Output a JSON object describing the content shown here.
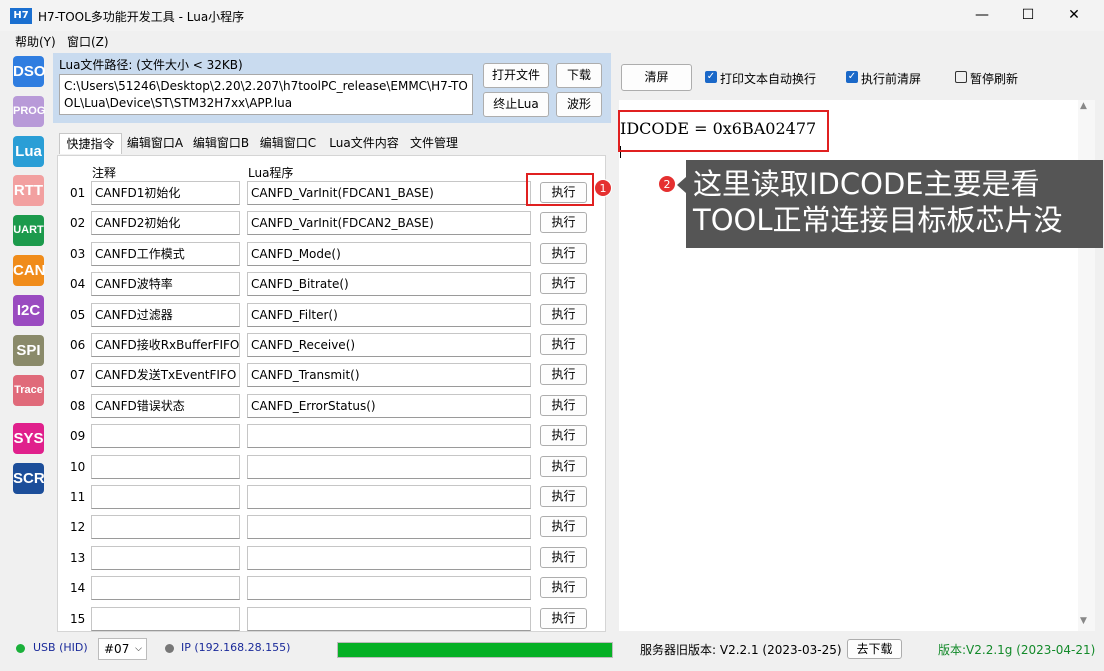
{
  "window": {
    "icon_text": "H7",
    "title": "H7-TOOL多功能开发工具 - Lua小程序",
    "controls": {
      "minimize": "—",
      "maximize": "☐",
      "close": "✕"
    }
  },
  "menu": {
    "items": [
      "帮助(Y)",
      "窗口(Z)"
    ]
  },
  "toolbar": {
    "items": [
      {
        "label": "DSO",
        "color": "#2f7de0"
      },
      {
        "label": "PROG",
        "color": "#b89ad8"
      },
      {
        "label": "Lua",
        "color": "#2a9ed6"
      },
      {
        "label": "RTT",
        "color": "#f2a0a0"
      },
      {
        "label": "UART",
        "color": "#1c9a4c"
      },
      {
        "label": "CAN",
        "color": "#f08c1a"
      },
      {
        "label": "I2C",
        "color": "#9a4bc0"
      },
      {
        "label": "SPI",
        "color": "#8a8a6a"
      },
      {
        "label": "Trace",
        "color": "#e06a7a"
      },
      {
        "label": "SYS",
        "color": "#e0208c"
      },
      {
        "label": "SCR",
        "color": "#1c4e9a"
      }
    ]
  },
  "path": {
    "label": "Lua文件路径: (文件大小 < 32KB)",
    "value": "C:\\Users\\51246\\Desktop\\2.20\\2.207\\h7toolPC_release\\EMMC\\H7-TOOL\\Lua\\Device\\ST\\STM32H7xx\\APP.lua",
    "buttons": {
      "open": "打开文件",
      "download": "下载",
      "stop": "终止Lua",
      "wave": "波形"
    }
  },
  "tabs": [
    "快捷指令",
    "编辑窗口A",
    "编辑窗口B",
    "编辑窗口C",
    "Lua文件内容",
    "文件管理"
  ],
  "table": {
    "header_comment": "注释",
    "header_program": "Lua程序",
    "exec_label": "执行",
    "rows": [
      {
        "num": "01",
        "comment": "CANFD1初始化",
        "program": "CANFD_VarInit(FDCAN1_BASE)"
      },
      {
        "num": "02",
        "comment": "CANFD2初始化",
        "program": "CANFD_VarInit(FDCAN2_BASE)"
      },
      {
        "num": "03",
        "comment": "CANFD工作模式",
        "program": "CANFD_Mode()"
      },
      {
        "num": "04",
        "comment": "CANFD波特率",
        "program": "CANFD_Bitrate()"
      },
      {
        "num": "05",
        "comment": "CANFD过滤器",
        "program": "CANFD_Filter()"
      },
      {
        "num": "06",
        "comment": "CANFD接收RxBufferFIFO",
        "program": "CANFD_Receive()"
      },
      {
        "num": "07",
        "comment": "CANFD发送TxEventFIFO",
        "program": "CANFD_Transmit()"
      },
      {
        "num": "08",
        "comment": "CANFD错误状态",
        "program": "CANFD_ErrorStatus()"
      },
      {
        "num": "09",
        "comment": "",
        "program": ""
      },
      {
        "num": "10",
        "comment": "",
        "program": ""
      },
      {
        "num": "11",
        "comment": "",
        "program": ""
      },
      {
        "num": "12",
        "comment": "",
        "program": ""
      },
      {
        "num": "13",
        "comment": "",
        "program": ""
      },
      {
        "num": "14",
        "comment": "",
        "program": ""
      },
      {
        "num": "15",
        "comment": "",
        "program": ""
      }
    ]
  },
  "right": {
    "clear_label": "清屏",
    "wrap_label": "打印文本自动换行",
    "clear_before_label": "执行前清屏",
    "pause_label": "暂停刷新",
    "output_text": "IDCODE = 0x6BA02477"
  },
  "annotations": {
    "badge1": "1",
    "badge2": "2",
    "note_line1": "这里读取IDCODE主要是看",
    "note_line2": "TOOL正常连接目标板芯片没"
  },
  "status": {
    "usb": "USB (HID)",
    "port": "#07",
    "ip": "IP (192.168.28.155)",
    "progress": 1.0,
    "server_version": "服务器旧版本: V2.2.1 (2023-03-25)",
    "download_btn": "去下载",
    "version": "版本:V2.2.1g (2023-04-21)"
  }
}
